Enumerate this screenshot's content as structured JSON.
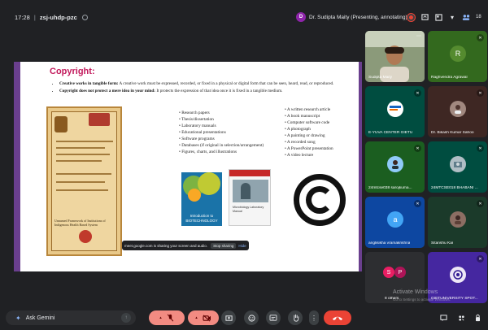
{
  "meeting": {
    "time": "17:28",
    "separator": "|",
    "code": "zsj-uhdp-pzc"
  },
  "presenter": {
    "avatar_letter": "D",
    "label": "Dr. Sudipta Maity (Presenting, annotating)"
  },
  "top_icons": {
    "people_count": "18"
  },
  "slide": {
    "title": "Copyright:",
    "bullets": [
      {
        "bold": "Creative works in tangible form:",
        "text": " A creative work must be expressed, recorded, or fixed in a physical or digital form that can be seen, heard, read, or reproduced."
      },
      {
        "bold": "Copyright does not protect a mere idea in your mind:",
        "text": " It protects the expression of that idea once it is fixed in a tangible medium."
      }
    ],
    "certificate_text": "Unnamed Framework of Institutions of Indigenous Health Based System",
    "list_middle": [
      "Research papers",
      "Thesis/dissertation",
      "Laboratory manuals",
      "Educational presentations",
      "Software programs",
      "Databases (if original in selection/arrangement)",
      "Figures, charts, and illustrations"
    ],
    "list_right": [
      "A written research article",
      "A book manuscript",
      "Computer software code",
      "A photograph",
      "A painting or drawing",
      "A recorded song",
      "A PowerPoint presentation",
      "A video lecture"
    ],
    "book1_title": "Introduction to BIOTECHNOLOGY",
    "book2_title": "Microbiology Laboratory Manual",
    "bottom_text": "outside the author's hand in a document."
  },
  "share_banner": {
    "text": "meet.google.com is sharing your screen and audio.",
    "stop_label": "Stop sharing",
    "hide_label": "Hide"
  },
  "participants": [
    {
      "name": "Sudipta Maity",
      "avatar": "",
      "color": "#7a8a6a"
    },
    {
      "name": "Raghvendra Agrawal",
      "avatar": "R",
      "color": "#33691e"
    },
    {
      "name": "E-YUVA CENTER GIETU",
      "avatar": "",
      "color": "#004d40"
    },
    {
      "name": "Dr. Bikash Kumar Sahoo",
      "avatar": "",
      "color": "#3e2723"
    },
    {
      "name": "24mtcse038 sarojkuma...",
      "avatar": "",
      "color": "#1b5e20"
    },
    {
      "name": "24MTCSE018 BHABANI ...",
      "avatar": "",
      "color": "#004d40"
    },
    {
      "name": "anglisikha vramakrishna",
      "avatar": "a",
      "color": "#0d47a1"
    },
    {
      "name": "Sitanshu Kar",
      "avatar": "",
      "color": "#1b3a2a"
    },
    {
      "name": "8 others",
      "avatar": "",
      "color": "#2d2e31"
    },
    {
      "name": "GIETUNIVERSITY SPOT...",
      "avatar": "",
      "color": "#4527a0"
    }
  ],
  "others_avatars": [
    "S",
    "P"
  ],
  "watermark": {
    "line1": "Activate Windows",
    "line2": "Go to Settings to activate Windows."
  },
  "bottom": {
    "ask_gemini": "Ask Gemini"
  },
  "colors": {
    "mic_off": "#f28b82",
    "hang_up": "#ea4335",
    "slide_accent": "#c2185b",
    "slide_border": "#6a3f8e"
  }
}
